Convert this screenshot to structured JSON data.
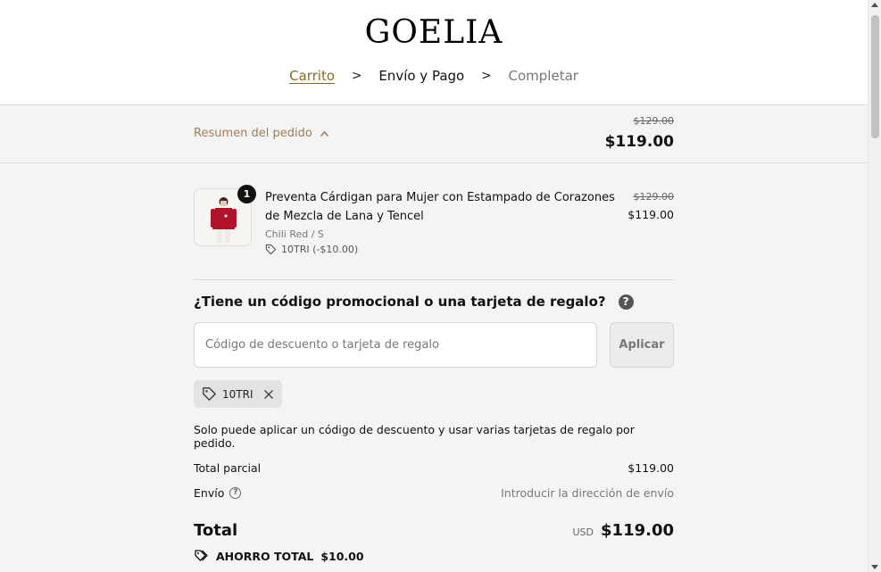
{
  "brand": {
    "logo_text": "GOELIA"
  },
  "breadcrumb": {
    "cart": "Carrito",
    "separator": ">",
    "shipping_payment": "Envío y Pago",
    "complete": "Completar"
  },
  "summary_bar": {
    "label": "Resumen del pedido",
    "old_price": "$129.00",
    "total": "$119.00"
  },
  "item": {
    "quantity": "1",
    "title": "Preventa Cárdigan para Mujer con Estampado de Corazones de Mezcla de Lana y Tencel",
    "variant": "Chili Red / S",
    "discount": "10TRI (-$10.00)",
    "old_price": "$129.00",
    "price": "$119.00"
  },
  "promo": {
    "heading": "¿Tiene un código promocional o una tarjeta de regalo?",
    "placeholder": "Código de descuento o tarjeta de regalo",
    "value": "",
    "apply_label": "Aplicar",
    "applied_code": "10TRI",
    "notice": "Solo puede aplicar un código de descuento y usar varias tarjetas de regalo por pedido."
  },
  "totals": {
    "subtotal_label": "Total parcial",
    "subtotal_value": "$119.00",
    "shipping_label": "Envío",
    "shipping_value": "Introducir la dirección de envío",
    "total_label": "Total",
    "currency": "USD",
    "total_value": "$119.00",
    "savings_label": "AHORRO TOTAL",
    "savings_value": "$10.00"
  },
  "icons": [
    "chevron-up-icon",
    "tag-icon",
    "help-icon",
    "close-icon",
    "question-circle-icon",
    "tags-icon"
  ],
  "colors": {
    "accent_link": "#8a6a1f",
    "summary_label": "#a07d5a",
    "product_red": "#b0132a"
  }
}
